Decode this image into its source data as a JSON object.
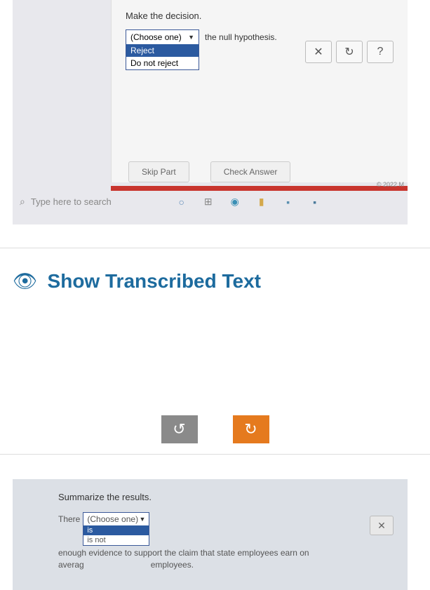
{
  "panel1": {
    "instruction": "Make the decision.",
    "dropdown": {
      "placeholder": "(Choose one)",
      "option1": "Reject",
      "option2": "Do not reject"
    },
    "hypothesis_text": "the null hypothesis.",
    "actions": {
      "close": "✕",
      "refresh": "↻",
      "help": "?"
    },
    "skip_label": "Skip Part",
    "check_label": "Check Answer",
    "copyright": "© 2022 M",
    "search_placeholder": "Type here to search"
  },
  "middle": {
    "transcribed_title": "Show Transcribed Text"
  },
  "panel2": {
    "instruction": "Summarize the results.",
    "text_before": "There",
    "dropdown": {
      "placeholder": "(Choose one)",
      "option1": "is",
      "option2": "is not"
    },
    "text_after1": "enough evidence to support the claim that state employees earn on",
    "text_line2a": "averag",
    "text_line2b": "employees.",
    "close": "✕"
  }
}
